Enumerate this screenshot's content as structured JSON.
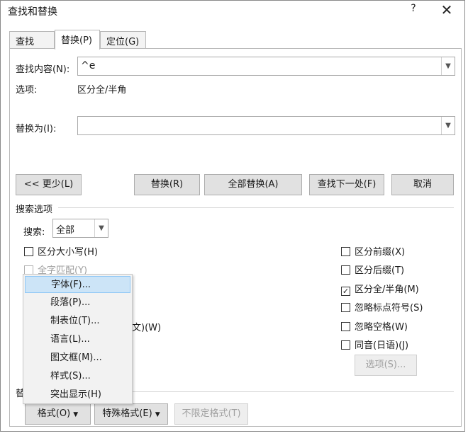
{
  "window": {
    "title": "查找和替换",
    "help_glyph": "?",
    "close_glyph": "✕"
  },
  "tabs": [
    {
      "label": "查找(D)"
    },
    {
      "label": "替换(P)"
    },
    {
      "label": "定位(G)"
    }
  ],
  "find": {
    "label": "查找内容(N):",
    "value": "^e",
    "options_label": "选项:",
    "options_value": "区分全/半角"
  },
  "replace": {
    "label": "替换为(I):",
    "value": ""
  },
  "buttons": {
    "less": "<< 更少(L)",
    "replace": "替换(R)",
    "replace_all": "全部替换(A)",
    "find_next": "查找下一处(F)",
    "cancel": "取消"
  },
  "search_options": {
    "heading": "搜索选项",
    "search_label": "搜索:",
    "search_value": "全部",
    "left_checks": [
      {
        "label": "区分大小写(H)",
        "checked": false,
        "disabled": false
      },
      {
        "label": "全字匹配(Y)",
        "checked": false,
        "disabled": true
      }
    ],
    "partial_left_text": "文)(W)",
    "right_checks": [
      {
        "label": "区分前缀(X)",
        "checked": false
      },
      {
        "label": "区分后缀(T)",
        "checked": false
      },
      {
        "label": "区分全/半角(M)",
        "checked": true
      },
      {
        "label": "忽略标点符号(S)",
        "checked": false
      },
      {
        "label": "忽略空格(W)",
        "checked": false
      },
      {
        "label": "同音(日语)(J)",
        "checked": false
      }
    ],
    "options_button": "选项(S)..."
  },
  "replace_section": {
    "heading_partial": "替"
  },
  "bottom_buttons": {
    "format": "格式(O)",
    "special": "特殊格式(E)",
    "no_format": "不限定格式(T)"
  },
  "format_menu": {
    "items": [
      {
        "label": "字体(F)...",
        "highlighted": true
      },
      {
        "label": "段落(P)..."
      },
      {
        "label": "制表位(T)..."
      },
      {
        "label": "语言(L)..."
      },
      {
        "label": "图文框(M)..."
      },
      {
        "label": "样式(S)..."
      },
      {
        "label": "突出显示(H)"
      }
    ]
  },
  "colors": {
    "button_bg": "#e1e1e1",
    "menu_highlight": "#cce4f7",
    "disabled_text": "#a0a0a0"
  }
}
